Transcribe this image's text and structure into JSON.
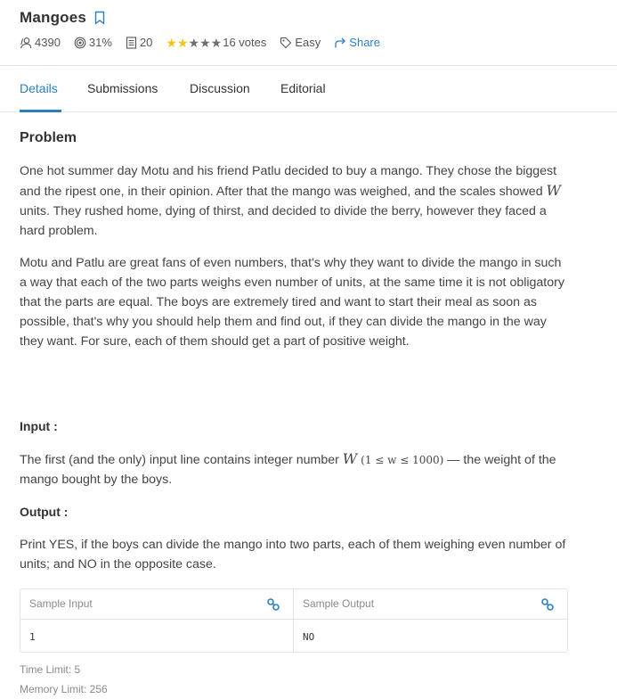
{
  "problem": {
    "title": "Mangoes"
  },
  "stats": {
    "attempts": "4390",
    "success_rate": "31%",
    "submissions": "20",
    "rating_value": 2,
    "rating_max": 5,
    "votes": "16 votes",
    "difficulty": "Easy",
    "share_label": "Share"
  },
  "tabs": [
    {
      "label": "Details",
      "active": true
    },
    {
      "label": "Submissions",
      "active": false
    },
    {
      "label": "Discussion",
      "active": false
    },
    {
      "label": "Editorial",
      "active": false
    }
  ],
  "content": {
    "problem_heading": "Problem",
    "para1_a": "One hot summer day Motu and his friend Patlu decided to buy a mango. They chose the biggest and the ripest one, in their opinion. After that the mango was weighed, and the scales showed ",
    "var_w": "W",
    "para1_b": " units. They rushed home, dying of thirst, and decided to divide the berry, however they faced a hard problem.",
    "para2": "Motu and Patlu are great fans of even numbers, that's why they want to divide the mango in such a way that each of the two parts weighs even number of units, at the same time it is not obligatory that the parts are equal. The boys are extremely tired and want to start their meal as soon as possible, that's why you should help them and find out, if they can divide the mango in the way they want. For sure, each of them should get a part of positive weight.",
    "input_heading": "Input :",
    "input_a": "The first (and the only) input line contains integer number ",
    "input_var": "W",
    "input_range": "(1 ≤ w ≤ 1000)",
    "input_b": " — the weight of the mango bought by the boys.",
    "output_heading": "Output :",
    "output_text": "Print YES, if the boys can divide the mango into two parts, each of them weighing even number of units; and NO in the opposite case."
  },
  "sample": {
    "input_label": "Sample Input",
    "output_label": "Sample Output",
    "input_value": "1",
    "output_value": "NO"
  },
  "limits": {
    "time": "Time Limit: 5",
    "memory": "Memory Limit: 256"
  },
  "colors": {
    "accent": "#2a7fc0",
    "star_on": "#f0c419",
    "star_off": "#6f6f6f"
  }
}
